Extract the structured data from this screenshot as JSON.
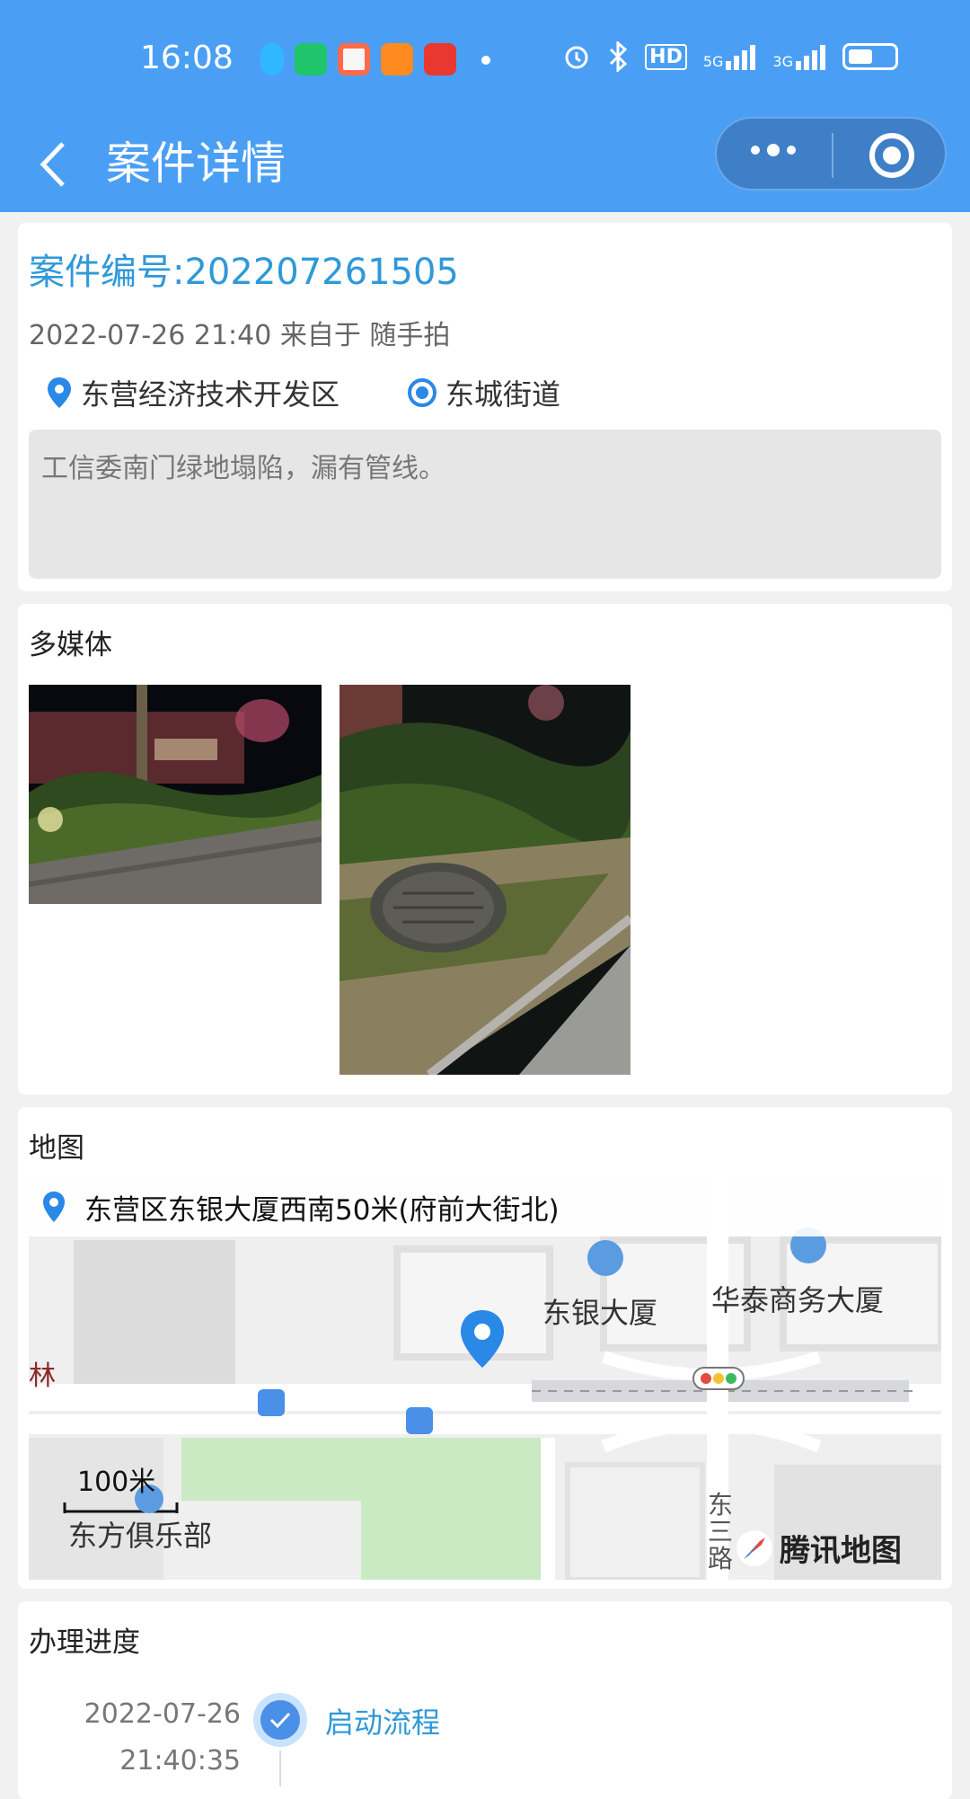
{
  "status_bar": {
    "time": "16:08",
    "network1": "5G",
    "network2": "3G",
    "hd_label": "HD"
  },
  "header": {
    "title": "案件详情"
  },
  "case": {
    "number_label": "案件编号:202207261505",
    "meta": "2022-07-26 21:40 来自于 随手拍",
    "district": "东营经济技术开发区",
    "street": "东城街道",
    "description": "工信委南门绿地塌陷，漏有管线。"
  },
  "media": {
    "title": "多媒体"
  },
  "map": {
    "title": "地图",
    "address": "东营区东银大厦西南50米(府前大街北)",
    "labels": {
      "dongyin": "东银大厦",
      "huatai": "华泰商务大厦",
      "lin": "林",
      "scale": "100米",
      "club": "东方俱乐部",
      "road": "东三路",
      "brand": "腾讯地图"
    }
  },
  "progress": {
    "title": "办理进度",
    "steps": [
      {
        "date": "2022-07-26",
        "time": "21:40:35",
        "label": "启动流程"
      }
    ]
  },
  "colors": {
    "header_blue": "#4a9ff5",
    "link_blue": "#2f99d8",
    "pin_blue": "#2a88e6"
  }
}
